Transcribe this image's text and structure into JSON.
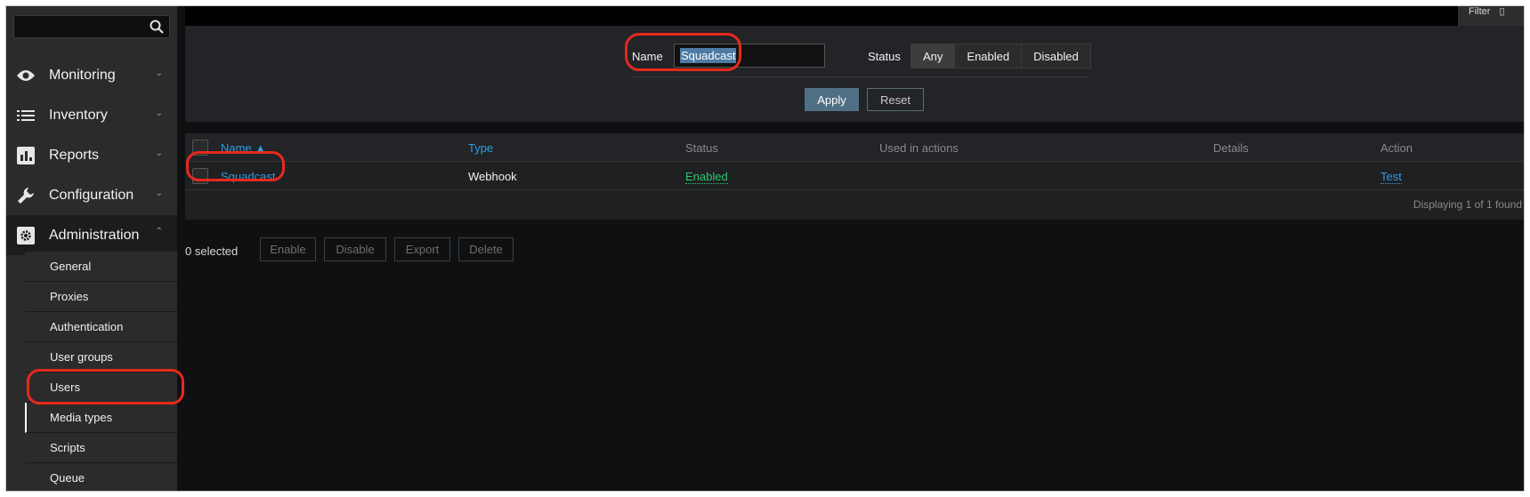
{
  "sidebar": {
    "search": {
      "placeholder": ""
    },
    "menu": [
      {
        "label": "Monitoring",
        "icon": "eye-icon"
      },
      {
        "label": "Inventory",
        "icon": "list-icon"
      },
      {
        "label": "Reports",
        "icon": "bar-chart-icon"
      },
      {
        "label": "Configuration",
        "icon": "wrench-icon"
      },
      {
        "label": "Administration",
        "icon": "gear-icon"
      }
    ],
    "submenu": [
      "General",
      "Proxies",
      "Authentication",
      "User groups",
      "Users",
      "Media types",
      "Scripts",
      "Queue"
    ],
    "active_submenu": "Media types"
  },
  "topbar": {
    "filter_label": "Filter"
  },
  "filter": {
    "name_label": "Name",
    "name_value": "Squadcast",
    "status_label": "Status",
    "status_options": [
      "Any",
      "Enabled",
      "Disabled"
    ],
    "status_selected": "Any",
    "apply_label": "Apply",
    "reset_label": "Reset"
  },
  "table": {
    "columns": [
      "Name ▲",
      "Type",
      "Status",
      "Used in actions",
      "Details",
      "Action"
    ],
    "rows": [
      {
        "name": "Squadcast",
        "type": "Webhook",
        "status": "Enabled",
        "used_in_actions": "",
        "details": "",
        "action": "Test"
      }
    ],
    "footer": "Displaying 1 of 1 found"
  },
  "actions": {
    "selected_count": "0 selected",
    "buttons": [
      "Enable",
      "Disable",
      "Export",
      "Delete"
    ]
  },
  "colors": {
    "accent_link": "#2e9ee0",
    "enabled": "#2ec66d",
    "annotation": "#e8291c",
    "apply_bg": "#4f6f84"
  }
}
